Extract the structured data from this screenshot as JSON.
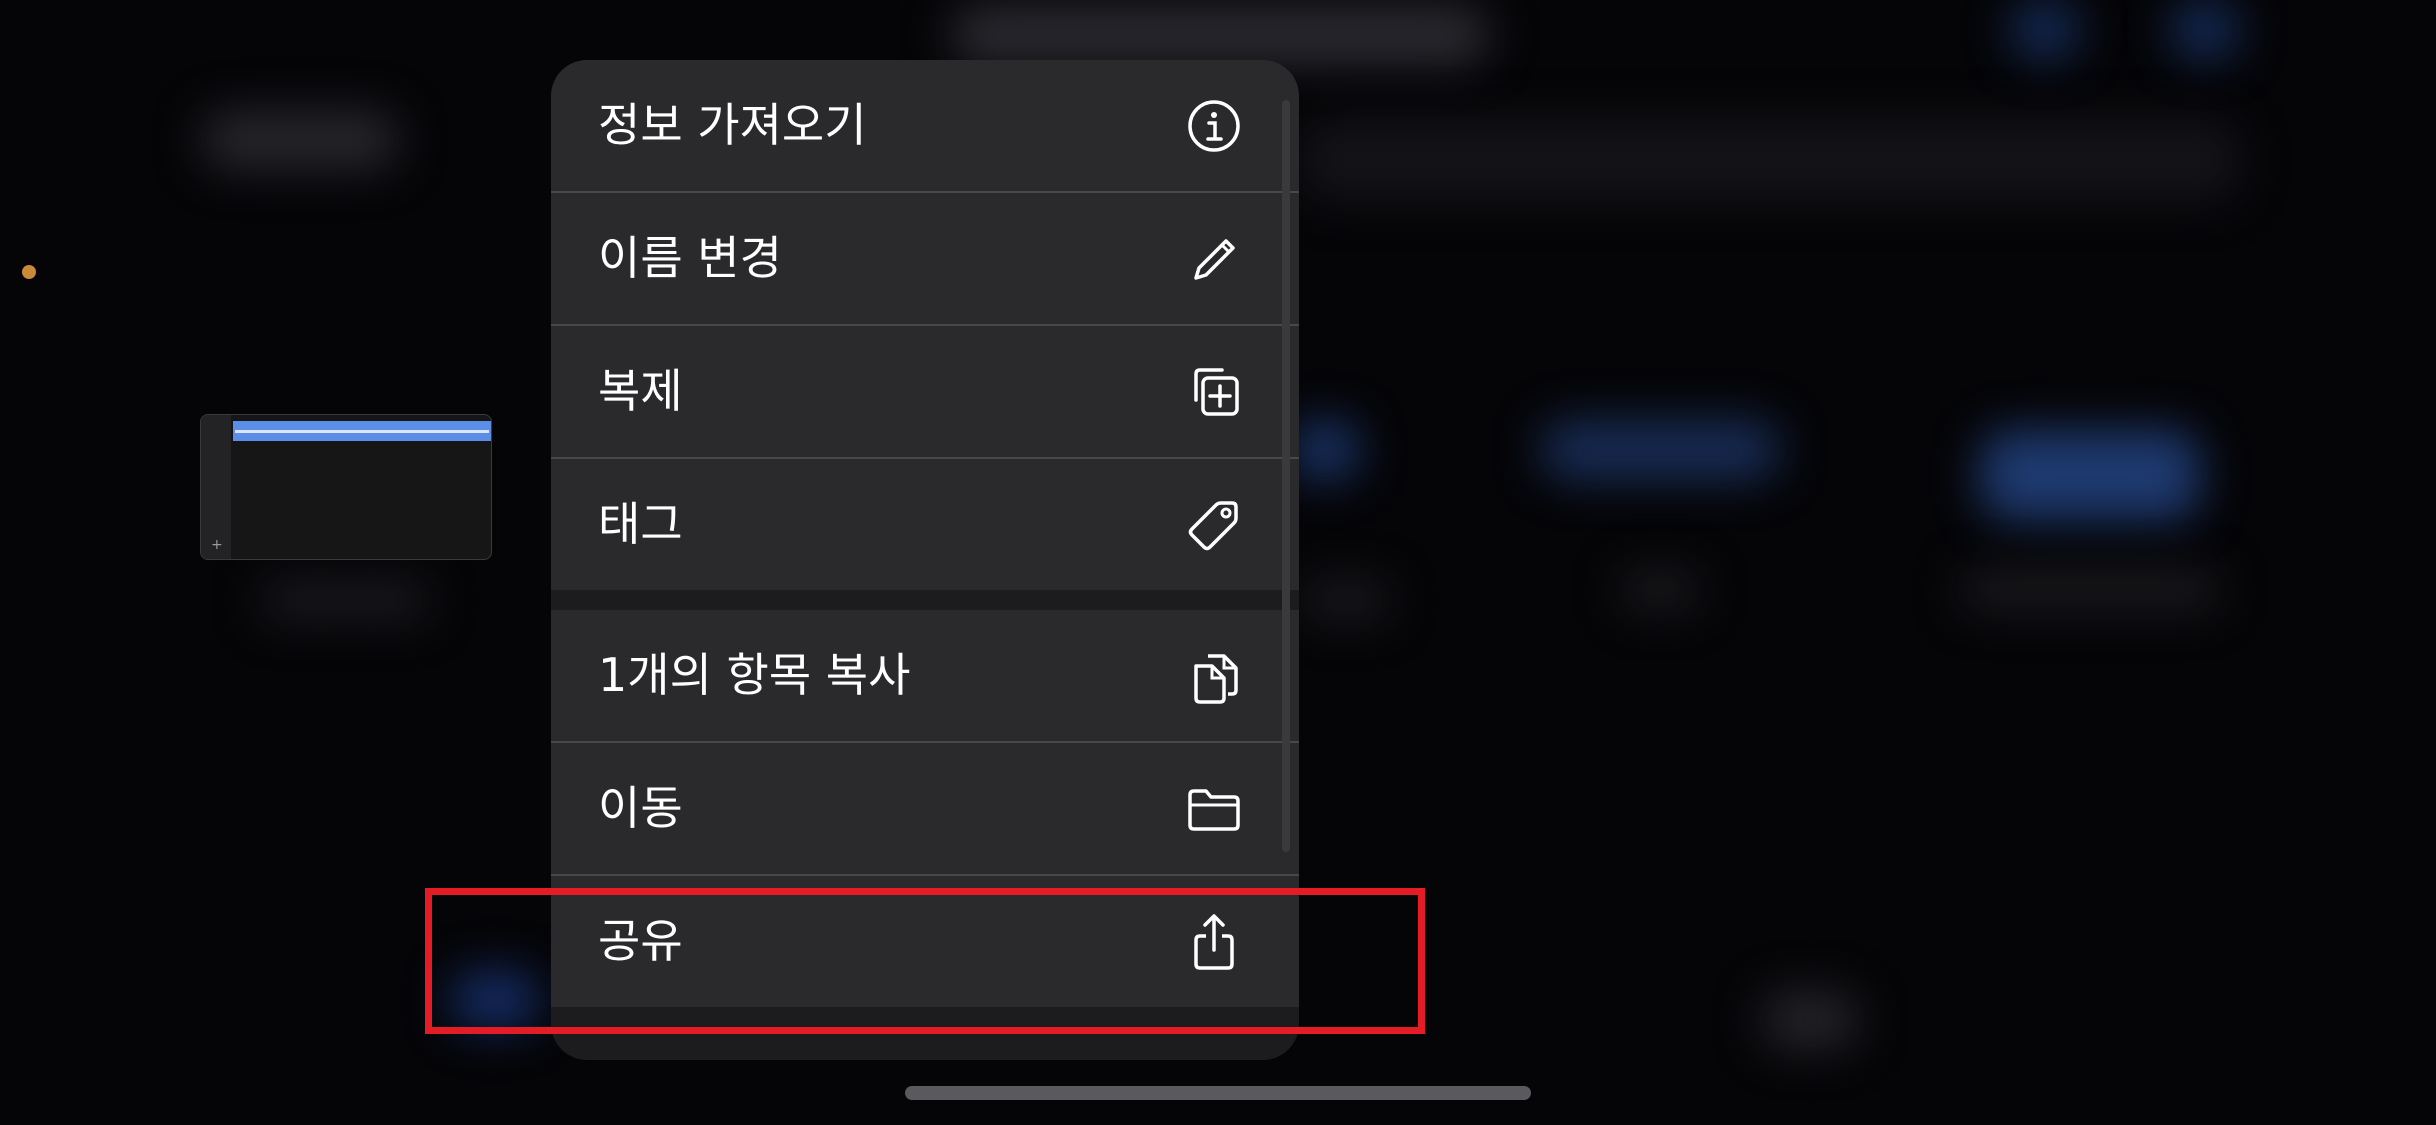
{
  "colors": {
    "background": "#050508",
    "menu_item": "#2a2a2c",
    "separator": "#48484a",
    "highlight": "#e31c25",
    "dot": "#c98a3a"
  },
  "menu": {
    "items": [
      {
        "label": "정보 가져오기",
        "icon": "info-circle-icon"
      },
      {
        "label": "이름 변경",
        "icon": "pencil-icon"
      },
      {
        "label": "복제",
        "icon": "duplicate-plus-icon"
      },
      {
        "label": "태그",
        "icon": "tag-icon"
      },
      {
        "label": "1개의 항목 복사",
        "icon": "copy-documents-icon"
      },
      {
        "label": "이동",
        "icon": "folder-icon"
      },
      {
        "label": "공유",
        "icon": "share-icon"
      }
    ]
  }
}
